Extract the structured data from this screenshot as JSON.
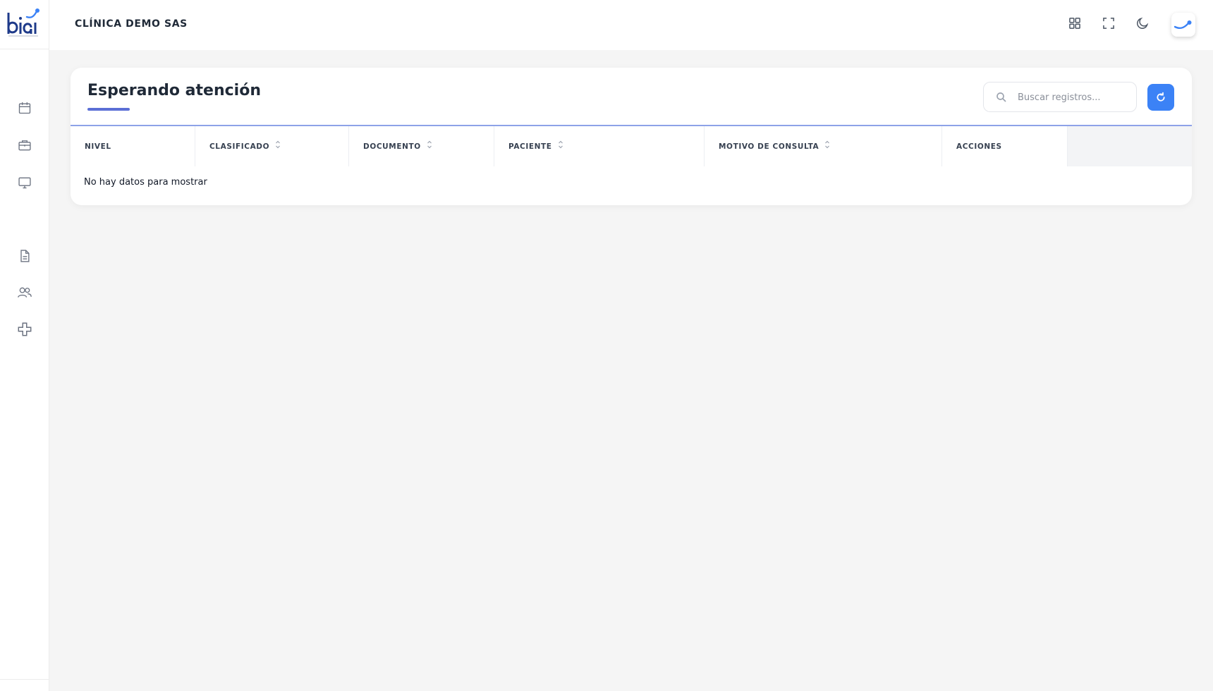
{
  "app": {
    "logo_text": "biai",
    "clinic_name": "CLÍNICA DEMO SAS"
  },
  "sidebar": {
    "items": [
      {
        "icon": "calendar-icon"
      },
      {
        "icon": "briefcase-icon"
      },
      {
        "icon": "monitor-icon"
      },
      {
        "icon": "document-icon"
      },
      {
        "icon": "users-icon"
      },
      {
        "icon": "medical-cross-icon"
      }
    ]
  },
  "header": {
    "icons": [
      "apps-grid-icon",
      "fullscreen-icon",
      "dark-mode-icon"
    ]
  },
  "card": {
    "title": "Esperando atención",
    "search": {
      "placeholder": "Buscar registros...",
      "value": ""
    },
    "refresh_icon": "refresh-icon"
  },
  "table": {
    "columns": [
      {
        "label": "NIVEL",
        "sortable": false
      },
      {
        "label": "CLASIFICADO",
        "sortable": true
      },
      {
        "label": "DOCUMENTO",
        "sortable": true
      },
      {
        "label": "PACIENTE",
        "sortable": true
      },
      {
        "label": "MOTIVO DE CONSULTA",
        "sortable": true
      },
      {
        "label": "ACCIONES",
        "sortable": false
      }
    ],
    "rows": [],
    "empty_message": "No hay datos para mostrar"
  },
  "colors": {
    "accent": "#3b82f6",
    "title_underline": "#5b6fd6",
    "table_border": "#8ea2e8",
    "background": "#f5f5f5"
  }
}
